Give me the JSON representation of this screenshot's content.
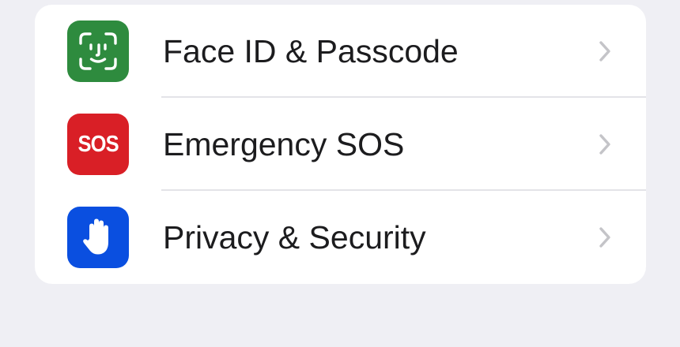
{
  "settings_group": {
    "items": [
      {
        "label": "Face ID & Passcode",
        "icon": "face-id-icon",
        "icon_color": "#2e8b3e",
        "chevron": "chevron-right-icon"
      },
      {
        "label": "Emergency SOS",
        "icon": "sos-icon",
        "icon_text": "SOS",
        "icon_color": "#d91f26",
        "chevron": "chevron-right-icon"
      },
      {
        "label": "Privacy & Security",
        "icon": "hand-raised-icon",
        "icon_color": "#0a4fe0",
        "chevron": "chevron-right-icon"
      }
    ]
  },
  "colors": {
    "background": "#efeff4",
    "card": "#ffffff",
    "text": "#1c1c1e",
    "chevron": "#c4c4c8",
    "separator": "#e3e3e8"
  }
}
